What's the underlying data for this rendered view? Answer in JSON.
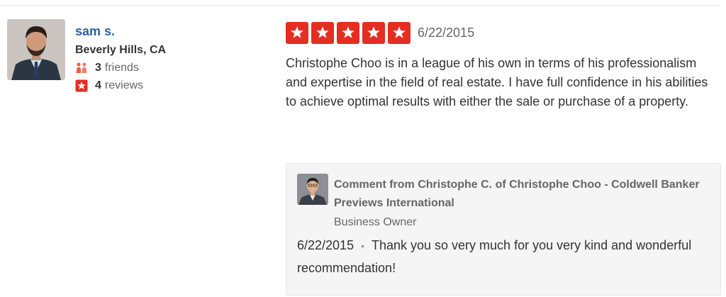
{
  "user": {
    "name": "sam s.",
    "location": "Beverly Hills, CA",
    "friends_count": "3",
    "friends_label": "friends",
    "reviews_count": "4",
    "reviews_label": "reviews"
  },
  "review": {
    "rating": 5,
    "rating_max": 5,
    "date": "6/22/2015",
    "text": "Christophe Choo is in a league of his own in terms of his professionalism and expertise in the field of real estate. I have full confidence in his abilities to achieve optimal results with either the sale or purchase of a property."
  },
  "owner_comment": {
    "title": "Comment from Christophe C. of Christophe Choo - Coldwell Banker Previews International",
    "role": "Business Owner",
    "date": "6/22/2015",
    "separator": "•",
    "text": "Thank you so very much for you very kind and wonderful recommendation!"
  },
  "colors": {
    "star_red": "#e62d22",
    "name_blue": "#2d60a7",
    "comment_bg": "#f5f5f5"
  },
  "icons": {
    "friends": "friends-icon",
    "reviews": "review-star-icon",
    "star": "star-icon"
  }
}
